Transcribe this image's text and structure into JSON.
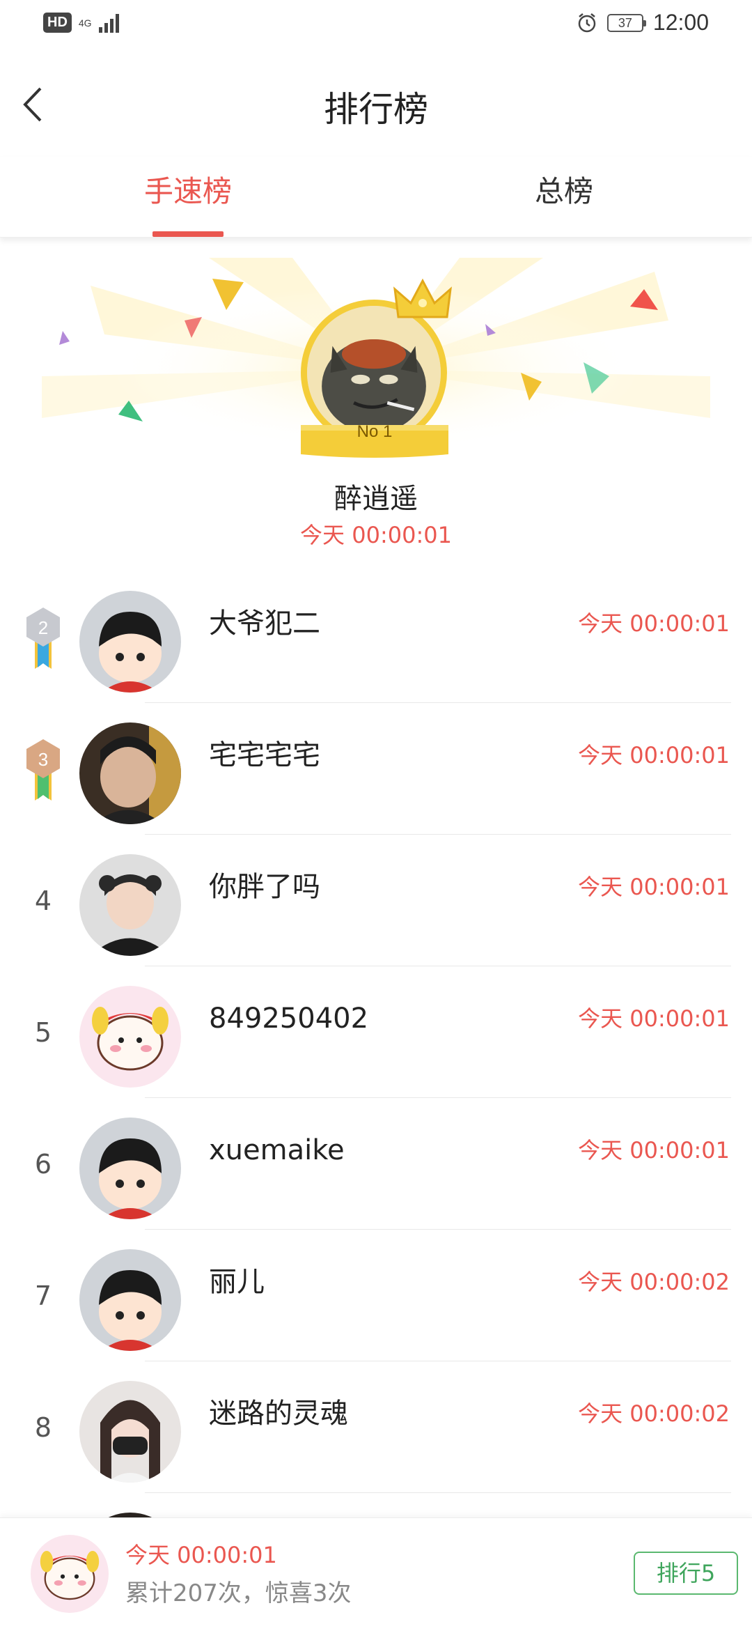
{
  "status": {
    "hd": "HD",
    "network": "4G",
    "battery": "37",
    "time": "12:00"
  },
  "header": {
    "title": "排行榜"
  },
  "tabs": [
    {
      "label": "手速榜",
      "active": true
    },
    {
      "label": "总榜",
      "active": false
    }
  ],
  "champion": {
    "badge": "No 1",
    "name": "醉逍遥",
    "time": "今天 00:00:01"
  },
  "rows": [
    {
      "rank": "2",
      "name": "大爷犯二",
      "time": "今天 00:00:01",
      "medal": "silver"
    },
    {
      "rank": "3",
      "name": "宅宅宅宅",
      "time": "今天 00:00:01",
      "medal": "bronze"
    },
    {
      "rank": "4",
      "name": "你胖了吗",
      "time": "今天 00:00:01"
    },
    {
      "rank": "5",
      "name": "849250402",
      "time": "今天 00:00:01"
    },
    {
      "rank": "6",
      "name": "xuemaike",
      "time": "今天 00:00:01"
    },
    {
      "rank": "7",
      "name": "丽儿",
      "time": "今天 00:00:02"
    },
    {
      "rank": "8",
      "name": "迷路的灵魂",
      "time": "今天 00:00:02"
    }
  ],
  "footer": {
    "time": "今天 00:00:01",
    "stats": "累计207次，惊喜3次",
    "rank_button": "排行5"
  },
  "colors": {
    "accent": "#ea5750",
    "green": "#3fa55c",
    "gold": "#f4cd39"
  }
}
